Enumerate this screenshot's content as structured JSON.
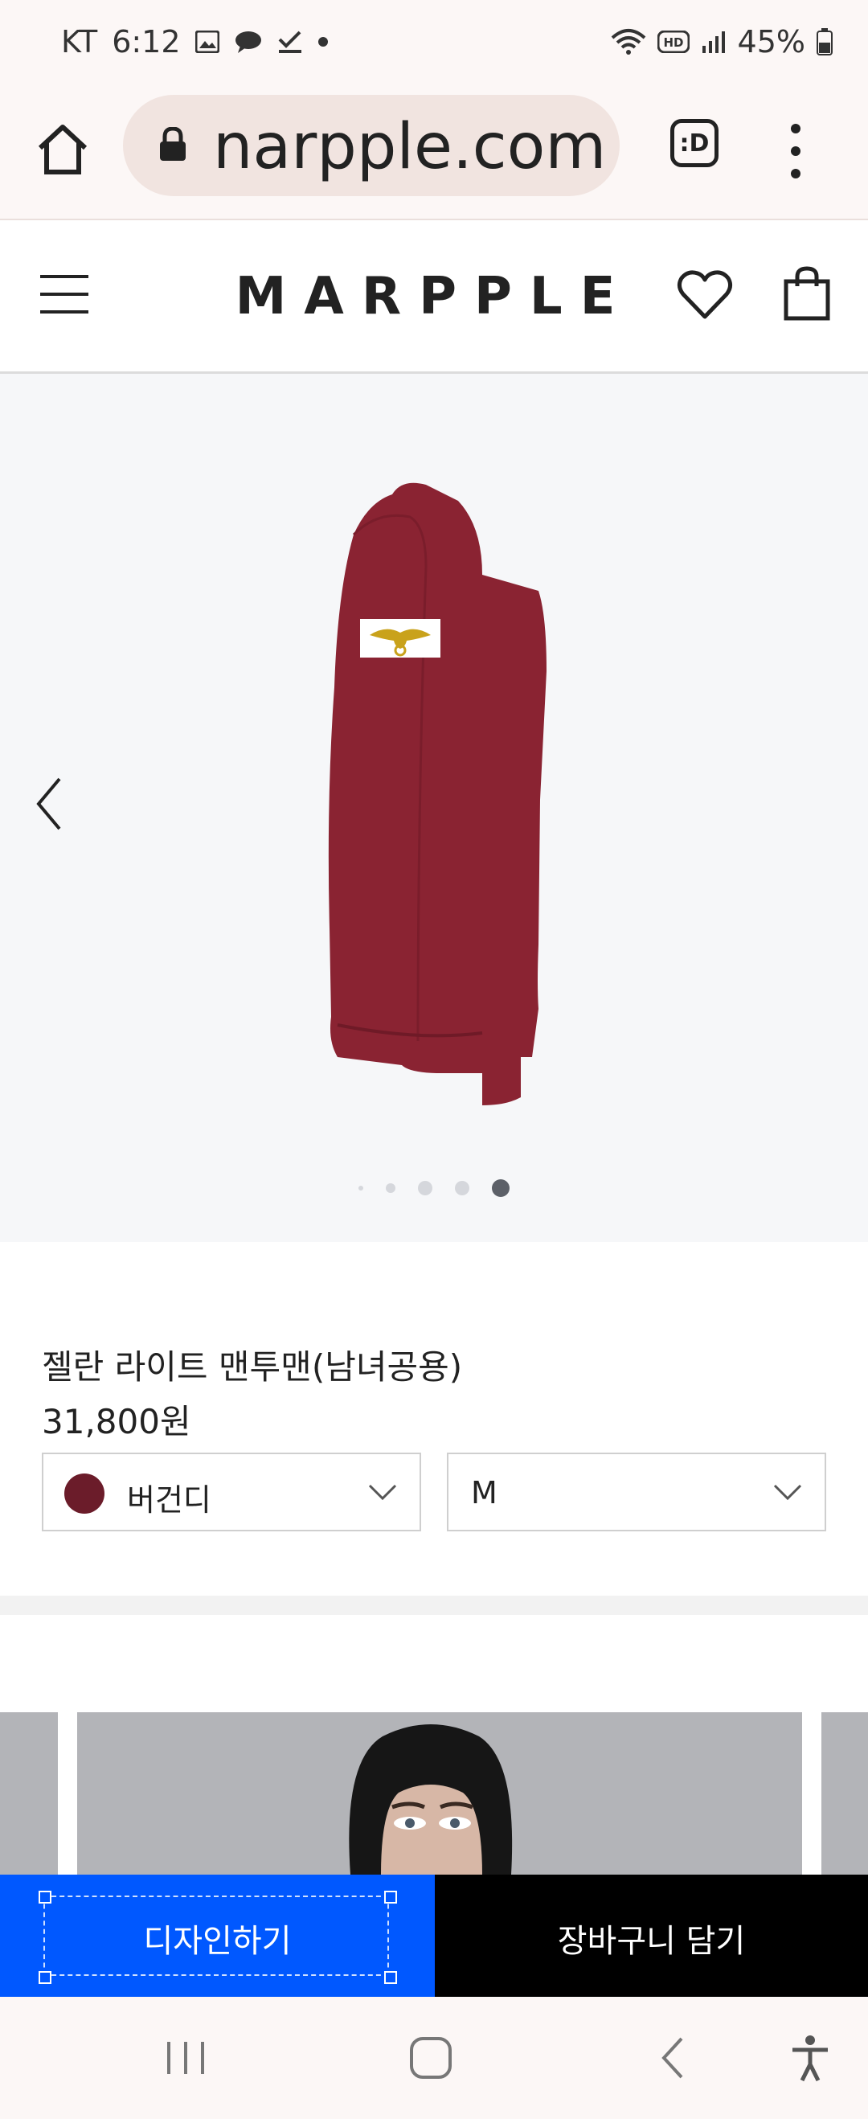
{
  "status_bar": {
    "carrier": "KT",
    "time": "6:12",
    "battery": "45%",
    "icons": [
      "image-icon",
      "chat-bubble-icon",
      "check-icon",
      "dot-icon",
      "wifi-icon",
      "hd-icon",
      "signal-icon",
      "battery-icon"
    ]
  },
  "browser": {
    "url": "narpple.com",
    "tab_label": ":D"
  },
  "site": {
    "logo": "MARPPLE"
  },
  "gallery": {
    "dots": 5,
    "active_index": 4
  },
  "product": {
    "name": "젤란 라이트 맨투맨(남녀공용)",
    "price": "31,800원",
    "color_option": "버건디",
    "color_hex": "#6b1c2a",
    "size_option": "M"
  },
  "actions": {
    "design_label": "디자인하기",
    "cart_label": "장바구니 담기"
  },
  "colors": {
    "accent": "#0058ff",
    "cart_bg": "#000000",
    "sweater": "#8a2332"
  }
}
